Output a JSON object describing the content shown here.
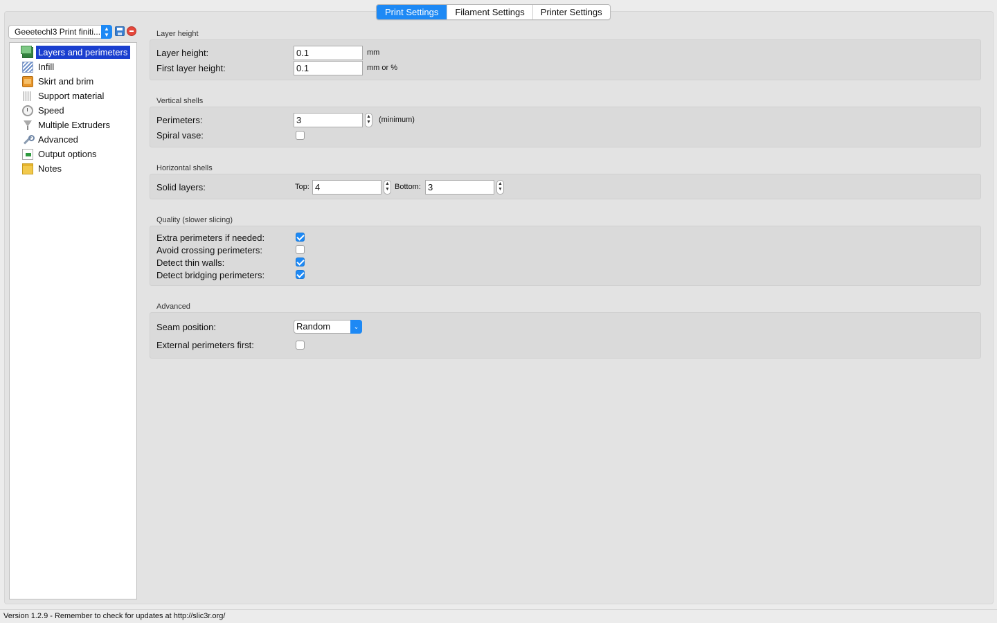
{
  "tabs": [
    "Print Settings",
    "Filament Settings",
    "Printer Settings"
  ],
  "active_tab": "Print Settings",
  "preset": {
    "value": "Geeetechl3 Print finiti..."
  },
  "sidebar": {
    "items": [
      {
        "label": "Layers and perimeters",
        "icon": "layers-icon",
        "selected": true
      },
      {
        "label": "Infill",
        "icon": "infill-icon"
      },
      {
        "label": "Skirt and brim",
        "icon": "skirt-icon"
      },
      {
        "label": "Support material",
        "icon": "support-icon"
      },
      {
        "label": "Speed",
        "icon": "speed-icon"
      },
      {
        "label": "Multiple Extruders",
        "icon": "funnel-icon"
      },
      {
        "label": "Advanced",
        "icon": "wrench-icon"
      },
      {
        "label": "Output options",
        "icon": "output-icon"
      },
      {
        "label": "Notes",
        "icon": "notes-icon"
      }
    ]
  },
  "layer_height": {
    "title": "Layer height",
    "layer_height_label": "Layer height:",
    "layer_height_value": "0.1",
    "layer_height_unit": "mm",
    "first_layer_label": "First layer height:",
    "first_layer_value": "0.1",
    "first_layer_unit": "mm or %"
  },
  "vertical_shells": {
    "title": "Vertical shells",
    "perimeters_label": "Perimeters:",
    "perimeters_value": "3",
    "perimeters_hint": "(minimum)",
    "spiral_vase_label": "Spiral vase:",
    "spiral_vase_checked": false
  },
  "horizontal_shells": {
    "title": "Horizontal shells",
    "solid_layers_label": "Solid layers:",
    "top_label": "Top:",
    "top_value": "4",
    "bottom_label": "Bottom:",
    "bottom_value": "3"
  },
  "quality": {
    "title": "Quality (slower slicing)",
    "items": [
      {
        "label": "Extra perimeters if needed:",
        "checked": true
      },
      {
        "label": "Avoid crossing perimeters:",
        "checked": false
      },
      {
        "label": "Detect thin walls:",
        "checked": true
      },
      {
        "label": "Detect bridging perimeters:",
        "checked": true
      }
    ]
  },
  "advanced": {
    "title": "Advanced",
    "seam_label": "Seam position:",
    "seam_value": "Random",
    "external_first_label": "External perimeters first:",
    "external_first_checked": false
  },
  "status_bar": "Version 1.2.9 - Remember to check for updates at http://slic3r.org/",
  "colors": {
    "accent": "#1d89f5",
    "selection": "#1a3fcf"
  }
}
